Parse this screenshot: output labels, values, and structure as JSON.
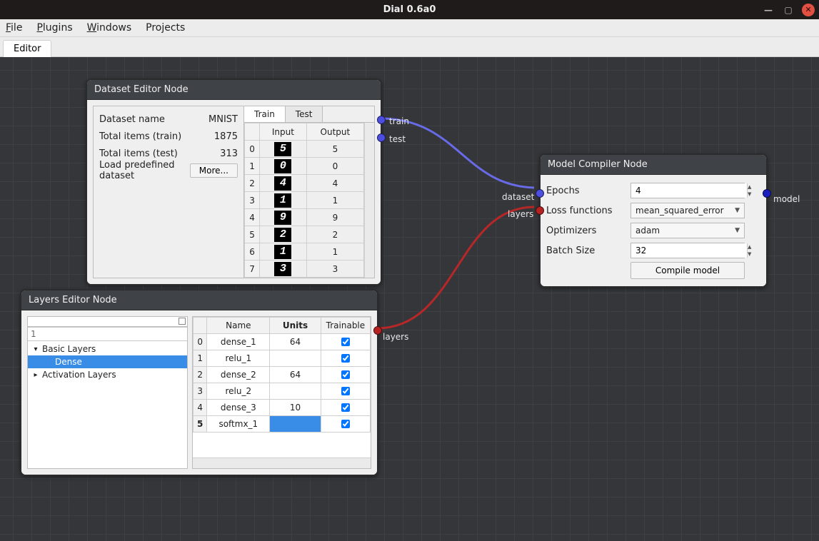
{
  "window": {
    "title": "Dial 0.6a0"
  },
  "menu": {
    "file": "File",
    "plugins": "Plugins",
    "windows": "Windows",
    "projects": "Projects"
  },
  "main_tabs": {
    "editor": "Editor"
  },
  "dataset_node": {
    "title": "Dataset Editor Node",
    "meta": {
      "name_label": "Dataset name",
      "name_value": "MNIST",
      "train_label": "Total items (train)",
      "train_value": "1875",
      "test_label": "Total items (test)",
      "test_value": "313",
      "load_label": "Load predefined dataset",
      "more_btn": "More..."
    },
    "tabs": {
      "train": "Train",
      "test": "Test"
    },
    "cols": {
      "input": "Input",
      "output": "Output"
    },
    "rows": [
      {
        "idx": "0",
        "digit": "5",
        "out": "5"
      },
      {
        "idx": "1",
        "digit": "0",
        "out": "0"
      },
      {
        "idx": "2",
        "digit": "4",
        "out": "4"
      },
      {
        "idx": "3",
        "digit": "1",
        "out": "1"
      },
      {
        "idx": "4",
        "digit": "9",
        "out": "9"
      },
      {
        "idx": "5",
        "digit": "2",
        "out": "2"
      },
      {
        "idx": "6",
        "digit": "1",
        "out": "1"
      },
      {
        "idx": "7",
        "digit": "3",
        "out": "3"
      }
    ],
    "ports": {
      "train": "train",
      "test": "test"
    }
  },
  "layers_node": {
    "title": "Layers Editor Node",
    "search_value": "1",
    "tree": {
      "basic": "Basic Layers",
      "dense": "Dense",
      "activation": "Activation Layers"
    },
    "cols": {
      "name": "Name",
      "units": "Units",
      "trainable": "Trainable"
    },
    "rows": [
      {
        "idx": "0",
        "name": "dense_1",
        "units": "64",
        "trainable": true
      },
      {
        "idx": "1",
        "name": "relu_1",
        "units": "",
        "trainable": true
      },
      {
        "idx": "2",
        "name": "dense_2",
        "units": "64",
        "trainable": true
      },
      {
        "idx": "3",
        "name": "relu_2",
        "units": "",
        "trainable": true
      },
      {
        "idx": "4",
        "name": "dense_3",
        "units": "10",
        "trainable": true
      },
      {
        "idx": "5",
        "name": "softmx_1",
        "units": "",
        "trainable": true,
        "selected": true
      }
    ],
    "ports": {
      "layers": "layers"
    }
  },
  "compiler_node": {
    "title": "Model Compiler Node",
    "epochs_label": "Epochs",
    "epochs_value": "4",
    "loss_label": "Loss functions",
    "loss_value": "mean_squared_error",
    "opt_label": "Optimizers",
    "opt_value": "adam",
    "batch_label": "Batch Size",
    "batch_value": "32",
    "compile_btn": "Compile model",
    "ports": {
      "dataset": "dataset",
      "layers": "layers",
      "model": "model"
    }
  },
  "colors": {
    "wire_train": "#686ae6",
    "wire_layers": "#b62828"
  }
}
